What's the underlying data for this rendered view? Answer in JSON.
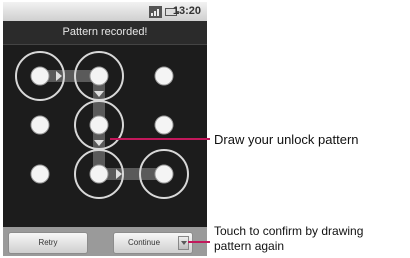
{
  "status_bar": {
    "time": "13:20"
  },
  "header": {
    "title": "Pattern recorded!"
  },
  "buttons": {
    "retry": "Retry",
    "continue": "Continue"
  },
  "callouts": {
    "draw": "Draw your unlock pattern",
    "confirm_line1": "Touch to confirm by drawing",
    "confirm_line2": "pattern again"
  },
  "pattern": {
    "sequence": [
      1,
      2,
      5,
      8,
      9
    ]
  },
  "colors": {
    "accent_line": "#c2185b",
    "path": "#5a5a5a"
  }
}
